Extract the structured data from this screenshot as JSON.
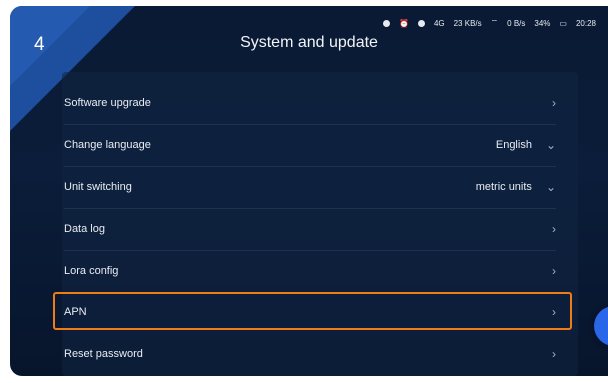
{
  "step_number": "4",
  "header": {
    "title": "System and update"
  },
  "status_bar": {
    "network": "4G",
    "data_speed": "23 KB/s",
    "wifi_speed": "0 B/s",
    "battery": "34%",
    "time": "20:28"
  },
  "settings": [
    {
      "label": "Software upgrade",
      "value": "",
      "control": "chevron-right"
    },
    {
      "label": "Change language",
      "value": "English",
      "control": "chevron-down"
    },
    {
      "label": "Unit switching",
      "value": "metric units",
      "control": "chevron-down"
    },
    {
      "label": "Data log",
      "value": "",
      "control": "chevron-right"
    },
    {
      "label": "Lora config",
      "value": "",
      "control": "chevron-right"
    },
    {
      "label": "APN",
      "value": "",
      "control": "chevron-right",
      "highlighted": true
    },
    {
      "label": "Reset password",
      "value": "",
      "control": "chevron-right"
    }
  ],
  "colors": {
    "highlight": "#f07c16",
    "accent": "#1d4f9e",
    "background": "#0a1a34"
  }
}
